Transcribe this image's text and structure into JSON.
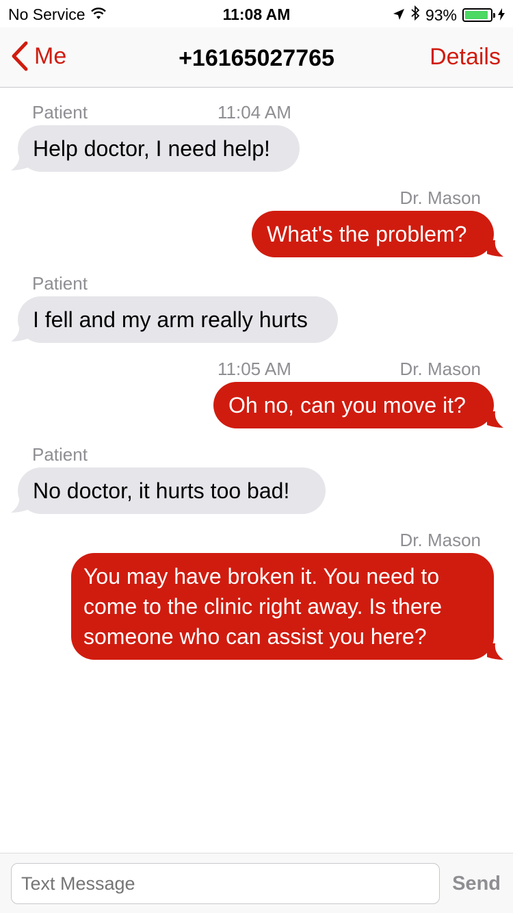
{
  "status_bar": {
    "carrier": "No Service",
    "time": "11:08 AM",
    "battery_percent": "93%",
    "battery_level": 0.93,
    "battery_color": "#4cd964",
    "icons": [
      "wifi-icon",
      "location-arrow-icon",
      "bluetooth-icon",
      "battery-icon",
      "charging-bolt-icon"
    ]
  },
  "nav": {
    "back_label": "Me",
    "title": "+16165027765",
    "details_label": "Details"
  },
  "messages": [
    {
      "sender": "Patient",
      "time": "11:04 AM",
      "text": "Help doctor, I need help!",
      "direction": "incoming"
    },
    {
      "sender": "Dr. Mason",
      "time": "",
      "text": "What's the problem?",
      "direction": "outgoing"
    },
    {
      "sender": "Patient",
      "time": "",
      "text": "I fell and my arm really hurts",
      "direction": "incoming"
    },
    {
      "sender": "Dr. Mason",
      "time": "11:05 AM",
      "text": "Oh no, can you move it?",
      "direction": "outgoing"
    },
    {
      "sender": "Patient",
      "time": "",
      "text": "No doctor, it hurts too bad!",
      "direction": "incoming"
    },
    {
      "sender": "Dr. Mason",
      "time": "",
      "text": "You may have broken it. You need to come to the clinic right away. Is there someone who can assist you here?",
      "direction": "outgoing"
    }
  ],
  "input": {
    "placeholder": "Text Message",
    "send_label": "Send"
  },
  "colors": {
    "accent": "#d01c0f",
    "incoming_bubble": "#e5e5ea",
    "meta_text": "#8e8e93"
  }
}
